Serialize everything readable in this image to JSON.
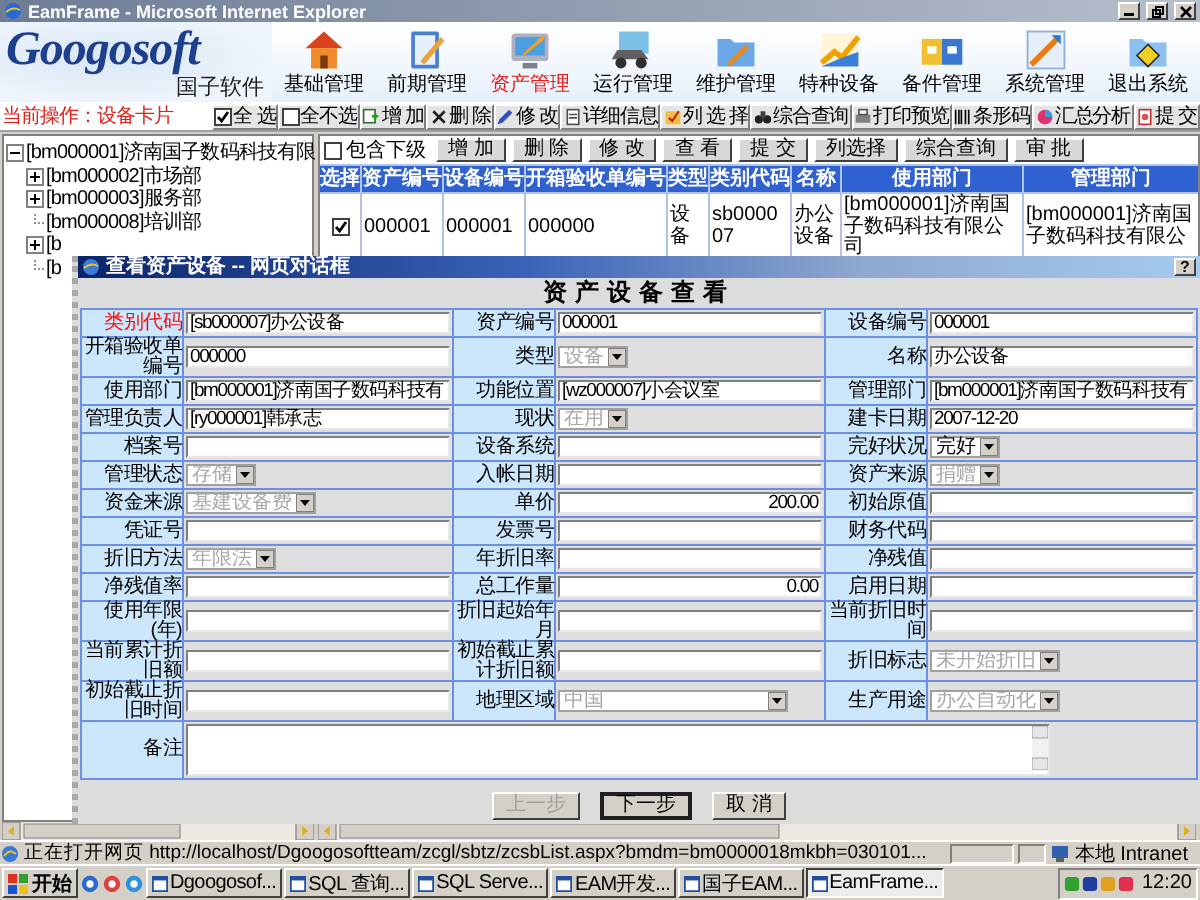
{
  "window": {
    "title": "EamFrame - Microsoft Internet Explorer"
  },
  "header": {
    "logo": "Googosoft",
    "logo_subtitle": "国子软件",
    "nav": [
      {
        "label": "基础管理",
        "selected": false
      },
      {
        "label": "前期管理",
        "selected": false
      },
      {
        "label": "资产管理",
        "selected": true
      },
      {
        "label": "运行管理",
        "selected": false
      },
      {
        "label": "维护管理",
        "selected": false
      },
      {
        "label": "特种设备",
        "selected": false
      },
      {
        "label": "备件管理",
        "selected": false
      },
      {
        "label": "系统管理",
        "selected": false
      },
      {
        "label": "退出系统",
        "selected": false
      }
    ]
  },
  "current_operation": "当前操作：设备卡片",
  "toolbar": [
    {
      "kind": "checkbox",
      "label": "全 选",
      "checked": true
    },
    {
      "kind": "checkbox",
      "label": "全不选",
      "checked": false
    },
    {
      "kind": "button",
      "label": "增 加"
    },
    {
      "kind": "button",
      "label": "删 除"
    },
    {
      "kind": "button",
      "label": "修 改"
    },
    {
      "kind": "button",
      "label": "详细信息"
    },
    {
      "kind": "button",
      "label": "列 选 择"
    },
    {
      "kind": "button",
      "label": "综合查询"
    },
    {
      "kind": "button",
      "label": "打印预览"
    },
    {
      "kind": "button",
      "label": "条形码"
    },
    {
      "kind": "button",
      "label": "汇总分析"
    },
    {
      "kind": "button",
      "label": "提 交"
    }
  ],
  "tree": {
    "items": [
      {
        "label": "[bm000001]济南国子数码科技有限",
        "kind": "folder",
        "expanded": true,
        "children": [
          {
            "label": "[bm000002]市场部",
            "kind": "folder",
            "expanded": false
          },
          {
            "label": "[bm000003]服务部",
            "kind": "folder",
            "expanded": false
          },
          {
            "label": "[bm000008]培训部",
            "kind": "leaf",
            "expanded": false
          },
          {
            "label": "[b",
            "kind": "folder",
            "expanded": false
          },
          {
            "label": "[b",
            "kind": "leaf",
            "expanded": false
          }
        ]
      }
    ]
  },
  "list_panel": {
    "include_sub": {
      "label": "包含下级",
      "checked": false
    },
    "buttons": [
      "增 加",
      "删 除",
      "修 改",
      "查 看",
      "提 交",
      "列选择",
      "综合查询",
      "审 批"
    ],
    "table": {
      "columns": [
        "选择",
        "资产编号",
        "设备编号",
        "开箱验收单编号",
        "类型",
        "类别代码",
        "名称",
        "使用部门",
        "管理部门"
      ],
      "rows": [
        {
          "checked": true,
          "cells": [
            "",
            "000001",
            "000001",
            "000000",
            "设备",
            "sb000007",
            "办公设备",
            "[bm000001]济南国子数码科技有限公司",
            "[bm000001]济南国子数码科技有限公"
          ]
        }
      ]
    }
  },
  "dialog": {
    "title": "查看资产设备 -- 网页对话框",
    "help": "?",
    "heading": "资产设备查看",
    "fields": [
      {
        "label": "类别代码",
        "highlighted": true,
        "kind": "text",
        "value": "[sb000007]办公设备",
        "right_aligned": false
      },
      {
        "label": "资产编号",
        "highlighted": false,
        "kind": "text",
        "value": "000001",
        "right_aligned": false
      },
      {
        "label": "设备编号",
        "highlighted": false,
        "kind": "text",
        "value": "000001",
        "right_aligned": false
      },
      {
        "label": "开箱验收单编号",
        "highlighted": false,
        "kind": "text",
        "value": "000000",
        "right_aligned": false
      },
      {
        "label": "类型",
        "highlighted": false,
        "kind": "select",
        "value": "设备",
        "disabled": true,
        "wide": false
      },
      {
        "label": "名称",
        "highlighted": false,
        "kind": "text",
        "value": "办公设备",
        "right_aligned": false
      },
      {
        "label": "使用部门",
        "highlighted": false,
        "kind": "text",
        "value": "[bm000001]济南国子数码科技有",
        "right_aligned": false
      },
      {
        "label": "功能位置",
        "highlighted": false,
        "kind": "text",
        "value": "[wz000007]小会议室",
        "right_aligned": false
      },
      {
        "label": "管理部门",
        "highlighted": false,
        "kind": "text",
        "value": "[bm000001]济南国子数码科技有",
        "right_aligned": false
      },
      {
        "label": "管理负责人",
        "highlighted": false,
        "kind": "text",
        "value": "[ry000001]韩承志",
        "right_aligned": false
      },
      {
        "label": "现状",
        "highlighted": false,
        "kind": "select",
        "value": "在用",
        "disabled": true,
        "wide": false
      },
      {
        "label": "建卡日期",
        "highlighted": false,
        "kind": "text",
        "value": "2007-12-20",
        "right_aligned": false
      },
      {
        "label": "档案号",
        "highlighted": false,
        "kind": "text"
      },
      {
        "label": "设备系统",
        "highlighted": false,
        "kind": "text"
      },
      {
        "label": "完好状况",
        "highlighted": false,
        "kind": "select",
        "value": "完好",
        "disabled": false,
        "wide": false
      },
      {
        "label": "管理状态",
        "highlighted": false,
        "kind": "select",
        "value": "存储",
        "disabled": true,
        "wide": false
      },
      {
        "label": "入帐日期",
        "highlighted": false,
        "kind": "text"
      },
      {
        "label": "资产来源",
        "highlighted": false,
        "kind": "select",
        "value": "捐赠",
        "disabled": true,
        "wide": false
      },
      {
        "label": "资金来源",
        "highlighted": false,
        "kind": "select",
        "value": "基建设备费",
        "disabled": true,
        "wide": false
      },
      {
        "label": "单价",
        "highlighted": false,
        "kind": "text",
        "value": "200.00",
        "right_aligned": true
      },
      {
        "label": "初始原值",
        "highlighted": false,
        "kind": "text"
      },
      {
        "label": "凭证号",
        "highlighted": false,
        "kind": "text"
      },
      {
        "label": "发票号",
        "highlighted": false,
        "kind": "text"
      },
      {
        "label": "财务代码",
        "highlighted": false,
        "kind": "text"
      },
      {
        "label": "折旧方法",
        "highlighted": false,
        "kind": "select",
        "value": "年限法",
        "disabled": true,
        "wide": false
      },
      {
        "label": "年折旧率",
        "highlighted": false,
        "kind": "text"
      },
      {
        "label": "净残值",
        "highlighted": false,
        "kind": "text"
      },
      {
        "label": "净残值率",
        "highlighted": false,
        "kind": "text"
      },
      {
        "label": "总工作量",
        "highlighted": false,
        "kind": "text",
        "value": "0.00",
        "right_aligned": true
      },
      {
        "label": "启用日期",
        "highlighted": false,
        "kind": "text"
      },
      {
        "label": "使用年限(年)",
        "highlighted": false,
        "kind": "text"
      },
      {
        "label": "折旧起始年月",
        "highlighted": false,
        "kind": "text"
      },
      {
        "label": "当前折旧时间",
        "highlighted": false,
        "kind": "text"
      },
      {
        "label": "当前累计折旧额",
        "highlighted": false,
        "kind": "text"
      },
      {
        "label": "初始截止累计折旧额",
        "highlighted": false,
        "kind": "text"
      },
      {
        "label": "折旧标志",
        "highlighted": false,
        "kind": "select",
        "value": "未开始折旧",
        "disabled": true,
        "wide": false
      },
      {
        "label": "初始截止折旧时间",
        "highlighted": false,
        "kind": "text"
      },
      {
        "label": "地理区域",
        "highlighted": false,
        "kind": "select",
        "value": "中国",
        "disabled": true,
        "wide": true
      },
      {
        "label": "生产用途",
        "highlighted": false,
        "kind": "select",
        "value": "办公自动化",
        "disabled": true,
        "wide": false
      }
    ],
    "remarks_label": "备注",
    "buttons": [
      {
        "label": "上一步",
        "disabled": true,
        "default": false
      },
      {
        "label": "下一步",
        "disabled": false,
        "default": true
      },
      {
        "label": "取 消",
        "disabled": false,
        "default": false
      }
    ]
  },
  "status_bar": {
    "text": "正在打开网页 http://localhost/Dgoogosoftteam/zcgl/sbtz/zcsbList.aspx?bmdm=bm0000018mkbh=030101...",
    "zone": "本地 Intranet"
  },
  "taskbar": {
    "start": "开始",
    "tasks": [
      {
        "label": "Dgoogosof...",
        "selected": false
      },
      {
        "label": "SQL 查询...",
        "selected": false
      },
      {
        "label": "SQL Serve...",
        "selected": false
      },
      {
        "label": "EAM开发...",
        "selected": false
      },
      {
        "label": "国子EAM...",
        "selected": false
      },
      {
        "label": "EamFrame...",
        "selected": true
      }
    ],
    "clock": "12:20"
  }
}
